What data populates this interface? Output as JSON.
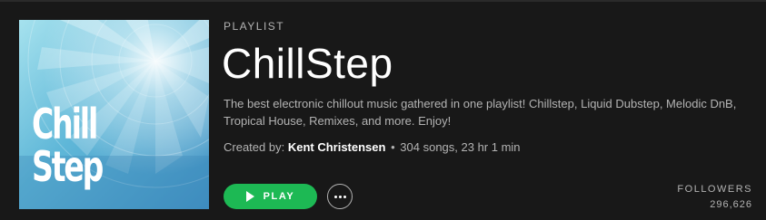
{
  "playlist": {
    "type_label": "PLAYLIST",
    "title": "ChillStep",
    "description": "The best electronic chillout music gathered in one playlist! Chillstep, Liquid Dubstep, Melodic DnB, Tropical House, Remixes, and more. Enjoy!",
    "created_by_label": "Created by:",
    "owner": "Kent Christensen",
    "separator": "•",
    "stats": "304 songs, 23 hr 1 min",
    "cover_art_text": "Chill\nStep"
  },
  "actions": {
    "play_label": "PLAY",
    "more_icon": "more-options-icon"
  },
  "followers": {
    "label": "FOLLOWERS",
    "count": "296,626"
  },
  "colors": {
    "background": "#181818",
    "accent": "#1db954",
    "muted_text": "#b3b3b3",
    "cover_base": "#5fb6d6"
  }
}
